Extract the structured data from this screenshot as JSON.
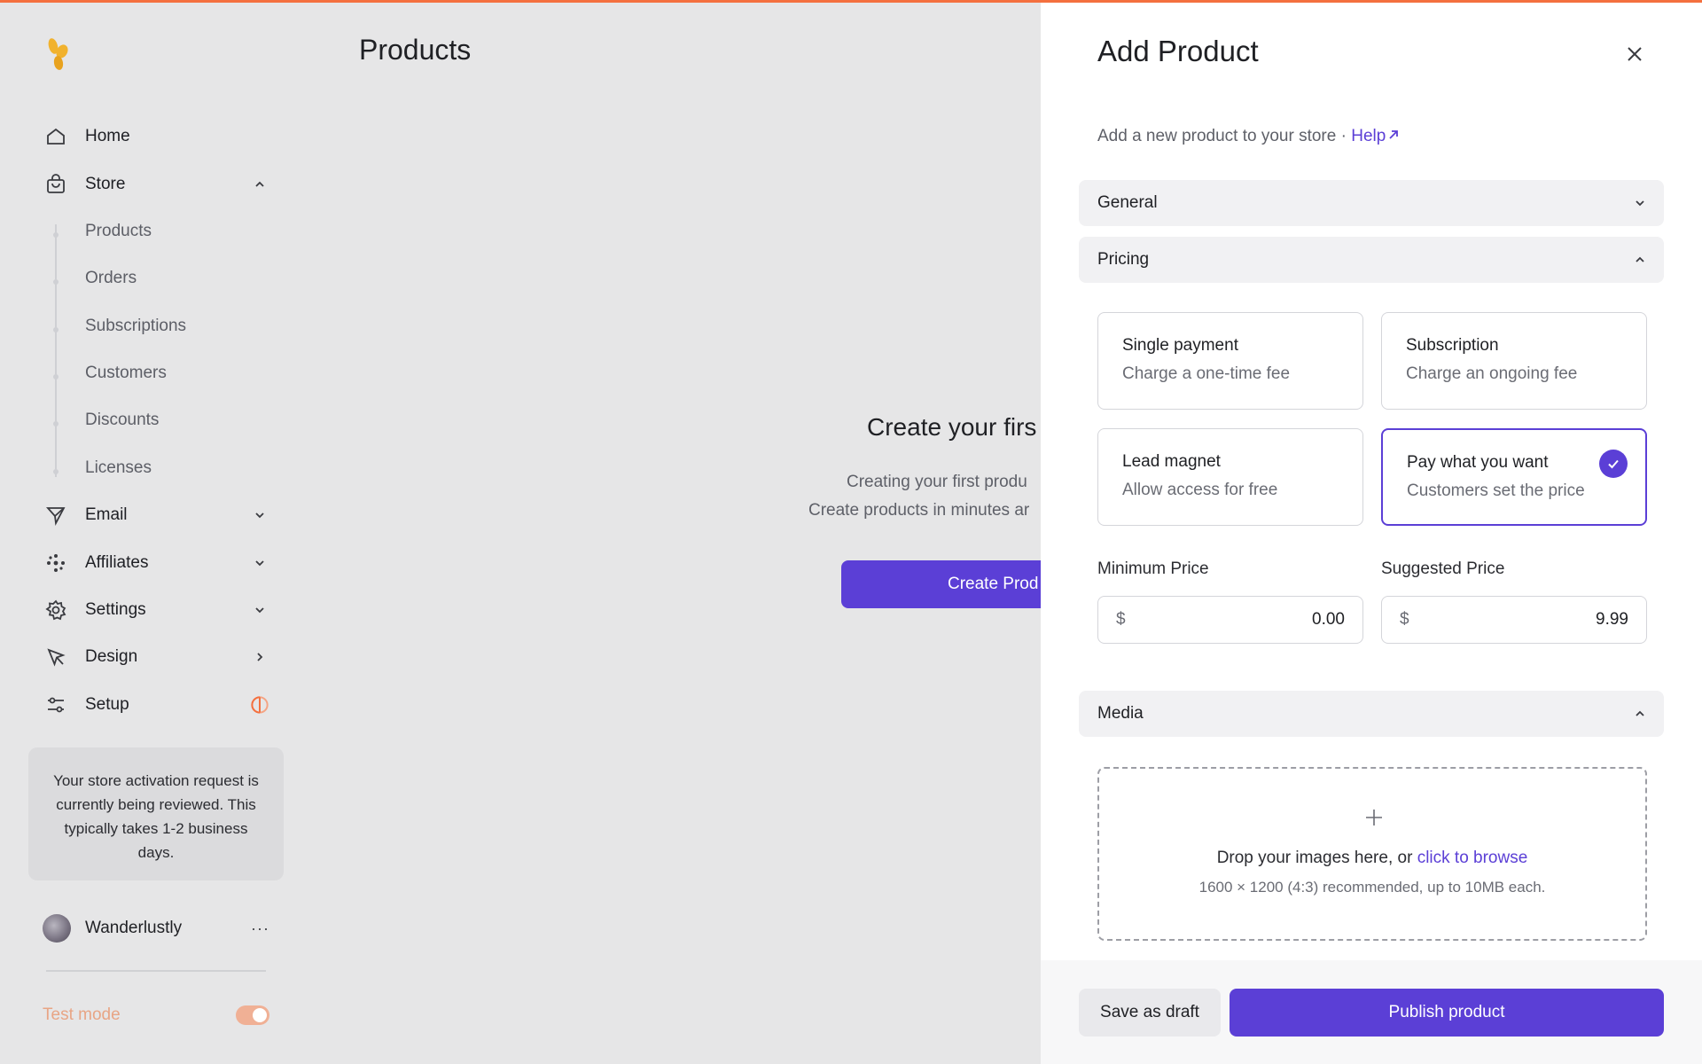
{
  "page": {
    "title": "Products"
  },
  "sidebar": {
    "nav": [
      {
        "label": "Home",
        "icon": "home-icon"
      },
      {
        "label": "Store",
        "icon": "shopping-bag-icon"
      },
      {
        "label": "Email",
        "icon": "paper-plane-icon"
      },
      {
        "label": "Affiliates",
        "icon": "network-icon"
      },
      {
        "label": "Settings",
        "icon": "gear-icon"
      },
      {
        "label": "Design",
        "icon": "cursor-arrow-icon"
      },
      {
        "label": "Setup",
        "icon": "sliders-icon"
      }
    ],
    "store_items": [
      "Products",
      "Orders",
      "Subscriptions",
      "Customers",
      "Discounts",
      "Licenses"
    ],
    "notice": "Your store activation request is currently being reviewed. This typically takes 1-2 business days.",
    "user": {
      "name": "Wanderlustly",
      "more": "···"
    },
    "test_mode": {
      "label": "Test mode",
      "enabled": true
    }
  },
  "empty_state": {
    "title": "Create your firs",
    "line1": "Creating your first produ",
    "line2": "Create products in minutes ar",
    "button": "Create Prod"
  },
  "drawer": {
    "title": "Add Product",
    "subtitle": "Add a new product to your store · ",
    "help": "Help",
    "sections": {
      "general": "General",
      "pricing": "Pricing",
      "media": "Media"
    },
    "options": [
      {
        "title": "Single payment",
        "desc": "Charge a one-time fee",
        "selected": false
      },
      {
        "title": "Subscription",
        "desc": "Charge an ongoing fee",
        "selected": false
      },
      {
        "title": "Lead magnet",
        "desc": "Allow access for free",
        "selected": false
      },
      {
        "title": "Pay what you want",
        "desc": "Customers set the price",
        "selected": true
      }
    ],
    "min_price": {
      "label": "Minimum Price",
      "currency": "$",
      "value": "0.00"
    },
    "suggested_price": {
      "label": "Suggested Price",
      "currency": "$",
      "value": "9.99"
    },
    "media": {
      "drop_text": "Drop your images here, or ",
      "browse": "click to browse",
      "hint": "1600 × 1200 (4:3) recommended, up to 10MB each."
    },
    "footer": {
      "draft": "Save as draft",
      "publish": "Publish product"
    }
  },
  "colors": {
    "accent": "#5b3fd6",
    "top_bar": "#f4703f",
    "logo": "#f1b22e"
  }
}
